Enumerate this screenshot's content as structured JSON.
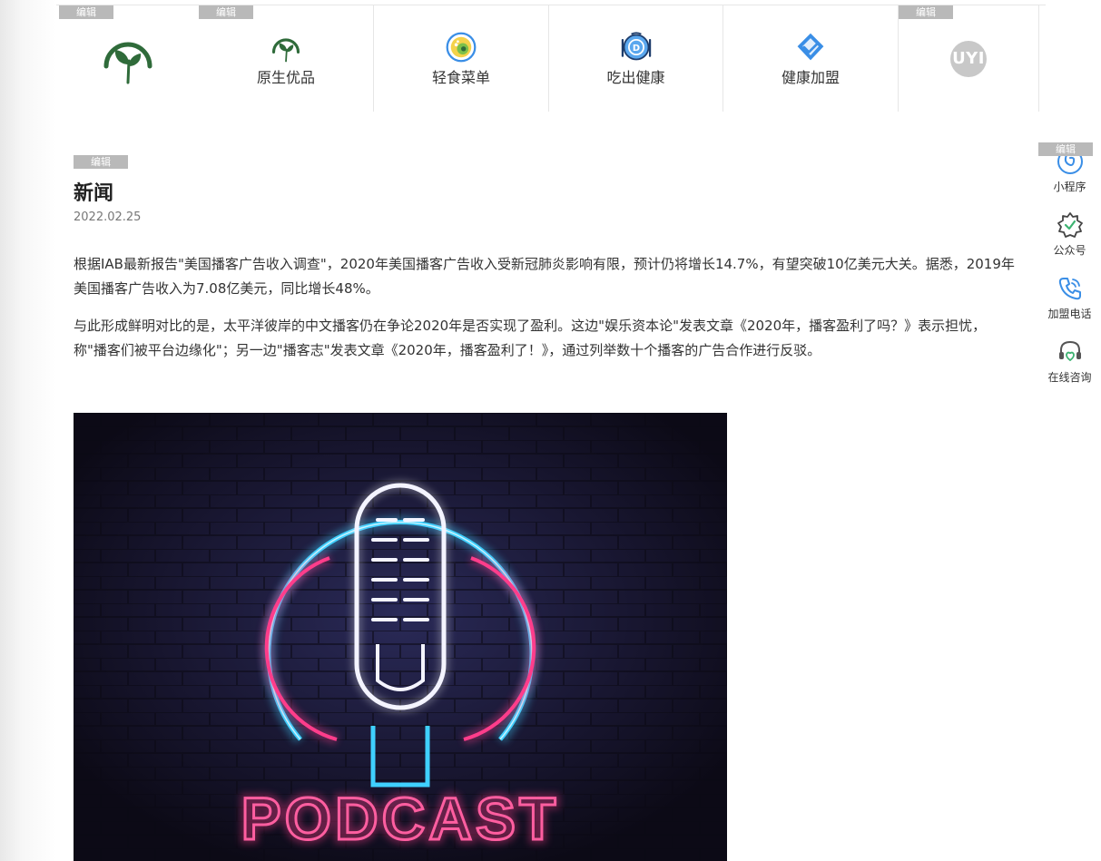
{
  "edit_tag": "编辑",
  "topnav": {
    "items": [
      {
        "label": "原生优品",
        "icon": "leaf-logo-icon"
      },
      {
        "label": "轻食菜单",
        "icon": "salad-bowl-icon"
      },
      {
        "label": "吃出健康",
        "icon": "plate-cutlery-icon"
      },
      {
        "label": "健康加盟",
        "icon": "handshake-icon"
      }
    ],
    "brand_badge": "UYI"
  },
  "article": {
    "title": "新闻",
    "date": "2022.02.25",
    "paragraphs": [
      "根据IAB最新报告\"美国播客广告收入调查\"，2020年美国播客广告收入受新冠肺炎影响有限，预计仍将增长14.7%，有望突破10亿美元大关。据悉，2019年美国播客广告收入为7.08亿美元，同比增长48%。",
      "与此形成鲜明对比的是，太平洋彼岸的中文播客仍在争论2020年是否实现了盈利。这边\"娱乐资本论\"发表文章《2020年，播客盈利了吗？》表示担忧，称\"播客们被平台边缘化\"；另一边\"播客志\"发表文章《2020年，播客盈利了！》，通过列举数十个播客的广告合作进行反驳。"
    ],
    "image_text": "PODCAST"
  },
  "sidebar": {
    "items": [
      {
        "label": "小程序",
        "icon": "mini-program-icon"
      },
      {
        "label": "公众号",
        "icon": "official-account-icon"
      },
      {
        "label": "加盟电话",
        "icon": "phone-icon"
      },
      {
        "label": "在线咨询",
        "icon": "headset-icon"
      }
    ]
  },
  "colors": {
    "brand_green": "#2f6b3a",
    "neon_blue": "#3fd0ff",
    "neon_pink": "#ff3d8b",
    "icon_blue": "#3a8ee6"
  }
}
